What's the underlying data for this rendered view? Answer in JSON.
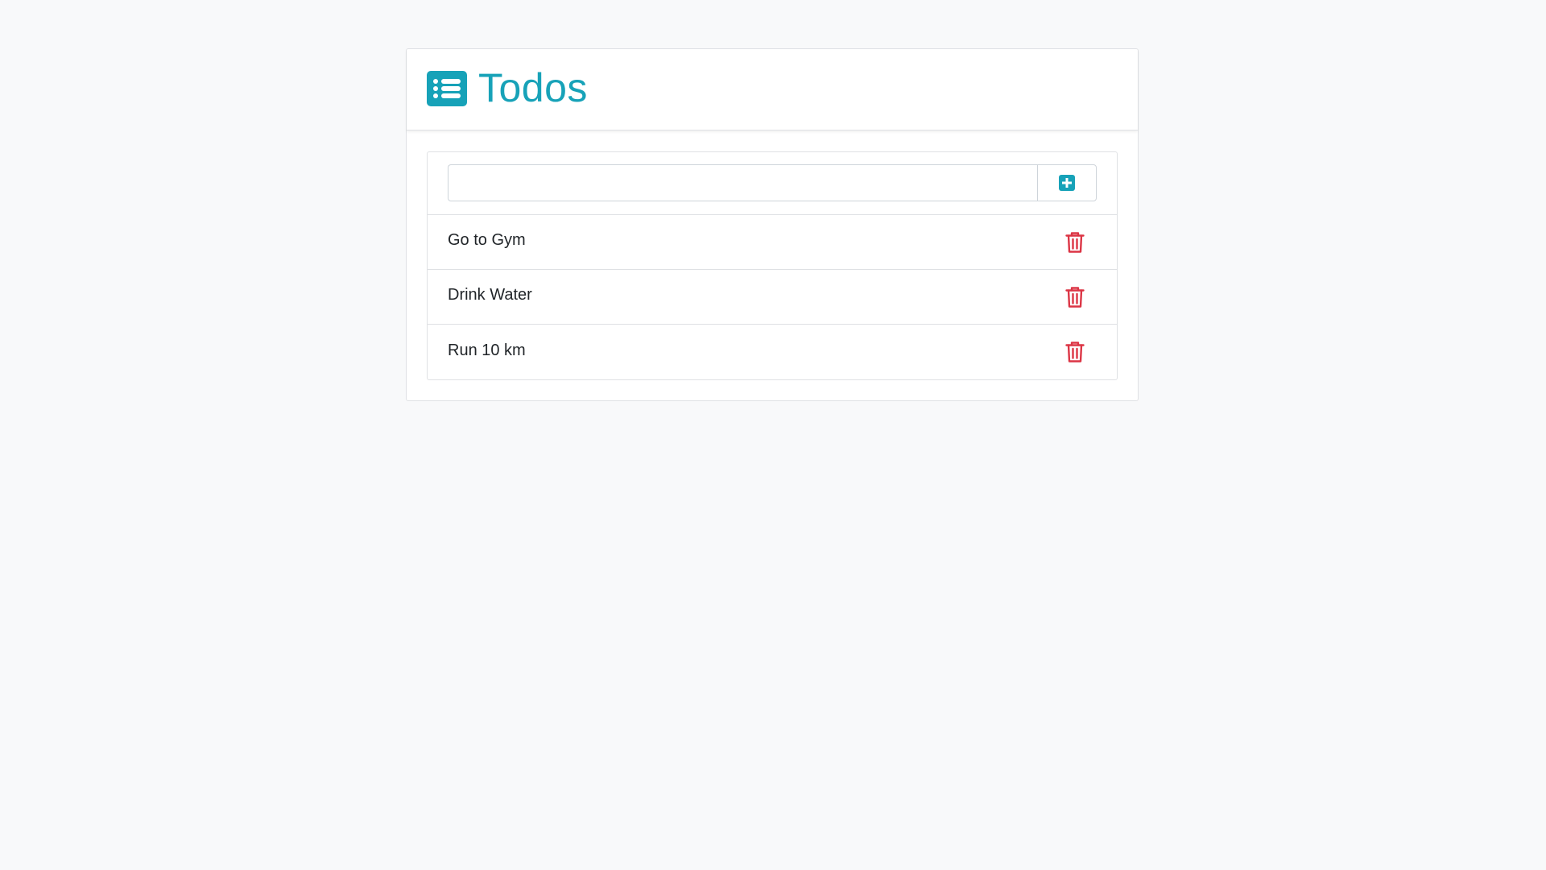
{
  "header": {
    "title": "Todos",
    "icon": "list-icon",
    "accent_color": "#17a2b8"
  },
  "form": {
    "input_value": "",
    "input_placeholder": "",
    "add_button_icon": "plus-square-icon"
  },
  "todos": [
    {
      "text": "Go to Gym",
      "delete_icon": "trash-icon"
    },
    {
      "text": "Drink Water",
      "delete_icon": "trash-icon"
    },
    {
      "text": "Run 10 km",
      "delete_icon": "trash-icon"
    }
  ],
  "colors": {
    "delete": "#dc3545",
    "background": "#f8f9fa"
  }
}
